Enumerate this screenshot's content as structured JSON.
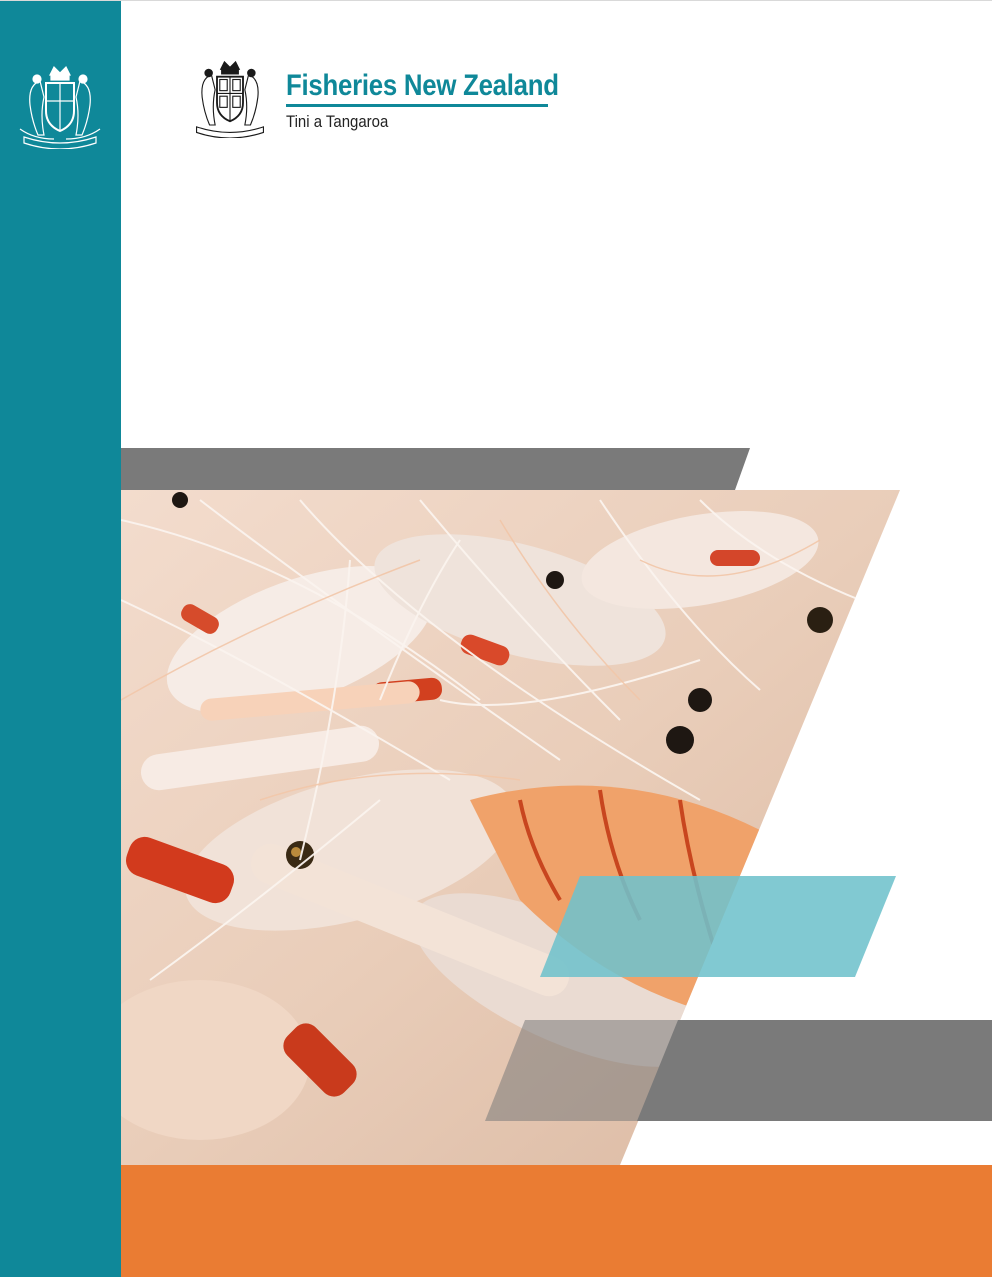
{
  "brand": {
    "name": "Fisheries New Zealand",
    "subtitle": "Tini a Tangaroa"
  },
  "colors": {
    "teal": "#0f8899",
    "light_teal": "#6fc1cc",
    "grey": "#7a7a7a",
    "orange": "#ea7c33",
    "brand_text": "#0f8899"
  },
  "icons": {
    "sidebar_crest": "nz-coat-of-arms-icon",
    "logo_crest": "nz-coat-of-arms-icon"
  },
  "cover_photo": {
    "subject": "langoustine / scampi catch"
  }
}
